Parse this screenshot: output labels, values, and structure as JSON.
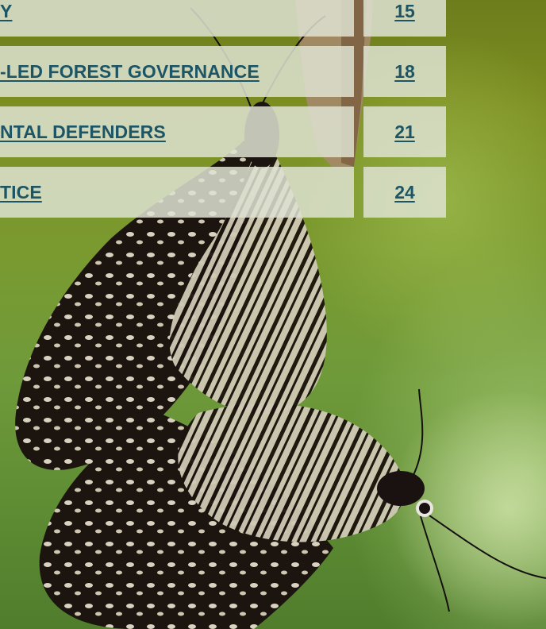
{
  "toc": {
    "rows": [
      {
        "title": "Y",
        "page": "15",
        "title_anchor": "right"
      },
      {
        "title": "-LED FOREST GOVERNANCE",
        "page": "18",
        "title_anchor": "right"
      },
      {
        "title": "NTAL DEFENDERS",
        "page": "21",
        "title_anchor": "right"
      },
      {
        "title": "TICE",
        "page": "24",
        "title_anchor": "right"
      }
    ]
  },
  "colors": {
    "text": "#1d5564",
    "cell_bg": "#dde2d0",
    "background_green": "#7a9a30"
  },
  "image": {
    "subject": "butterflies-mating-icon"
  }
}
